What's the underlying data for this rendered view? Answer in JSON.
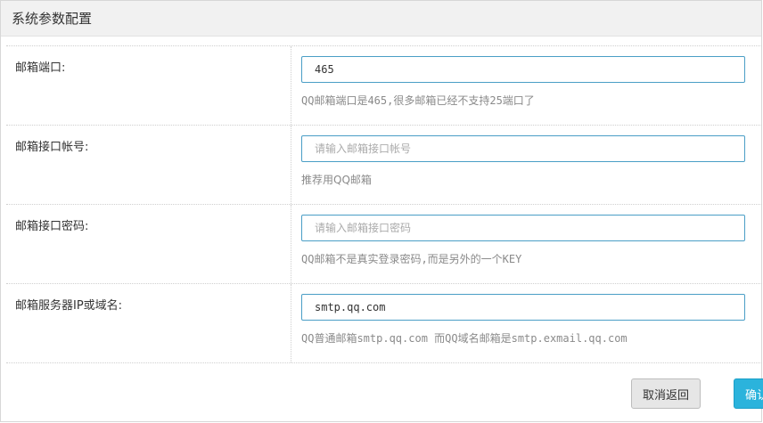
{
  "panel": {
    "title": "系统参数配置"
  },
  "form": {
    "rows": [
      {
        "label": "邮箱端口:",
        "value": "465",
        "placeholder": "",
        "hint": "QQ邮箱端口是465,很多邮箱已经不支持25端口了"
      },
      {
        "label": "邮箱接口帐号:",
        "value": "",
        "placeholder": "请输入邮箱接口帐号",
        "hint": "推荐用QQ邮箱"
      },
      {
        "label": "邮箱接口密码:",
        "value": "",
        "placeholder": "请输入邮箱接口密码",
        "hint": "QQ邮箱不是真实登录密码,而是另外的一个KEY"
      },
      {
        "label": "邮箱服务器IP或域名:",
        "value": "smtp.qq.com",
        "placeholder": "",
        "hint": "QQ普通邮箱smtp.qq.com 而QQ域名邮箱是smtp.exmail.qq.com"
      }
    ]
  },
  "actions": {
    "cancel_label": "取消返回",
    "confirm_label": "确认"
  },
  "colors": {
    "input_border": "#4a9ec6",
    "confirm_bg": "#2bb3dc",
    "cancel_bg": "#e6e6e6",
    "header_bg": "#f1f1f1"
  }
}
